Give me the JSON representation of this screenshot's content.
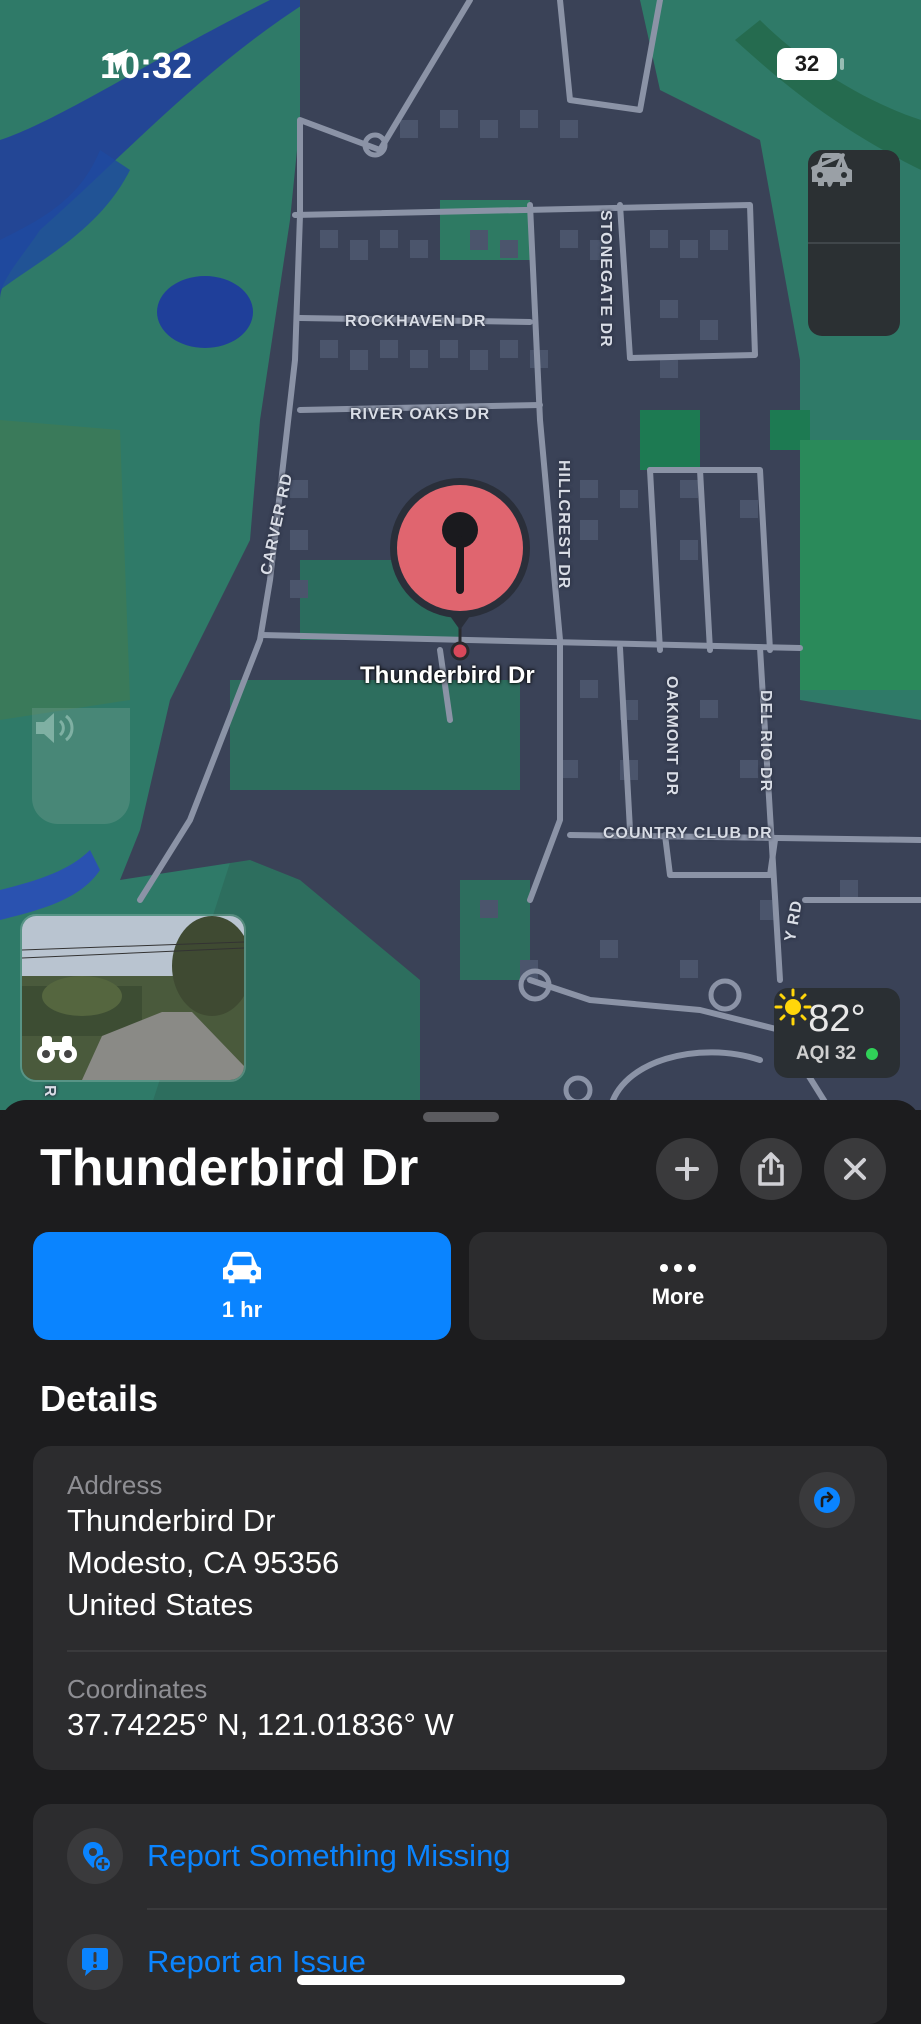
{
  "status_bar": {
    "time": "10:32",
    "battery": "32"
  },
  "map": {
    "streets": {
      "rockhaven": "ROCKHAVEN DR",
      "river_oaks": "RIVER OAKS DR",
      "stonegate": "STONEGATE DR",
      "hillcrest": "HILLCREST DR",
      "carver": "CARVER RD",
      "oakmont": "OAKMONT DR",
      "del_rio": "DEL RIO DR",
      "country_club": "COUNTRY CLUB DR",
      "partial_right": "Y RD",
      "partial_left": "R"
    },
    "pin_label": "Thunderbird Dr",
    "weather": {
      "temp": "82°",
      "aqi": "AQI 32"
    }
  },
  "sheet": {
    "title": "Thunderbird Dr",
    "actions": {
      "drive_time": "1 hr",
      "more": "More"
    },
    "details_heading": "Details",
    "address": {
      "label": "Address",
      "line1": "Thunderbird Dr",
      "line2": "Modesto, CA  95356",
      "line3": "United States"
    },
    "coordinates": {
      "label": "Coordinates",
      "value": "37.74225° N, 121.01836° W"
    },
    "report": {
      "missing": "Report Something Missing",
      "issue": "Report an Issue"
    }
  },
  "colors": {
    "accent": "#0a84ff",
    "pin": "#e0656f",
    "map_green": "#2f7a68",
    "map_blocks": "#3a4257"
  }
}
